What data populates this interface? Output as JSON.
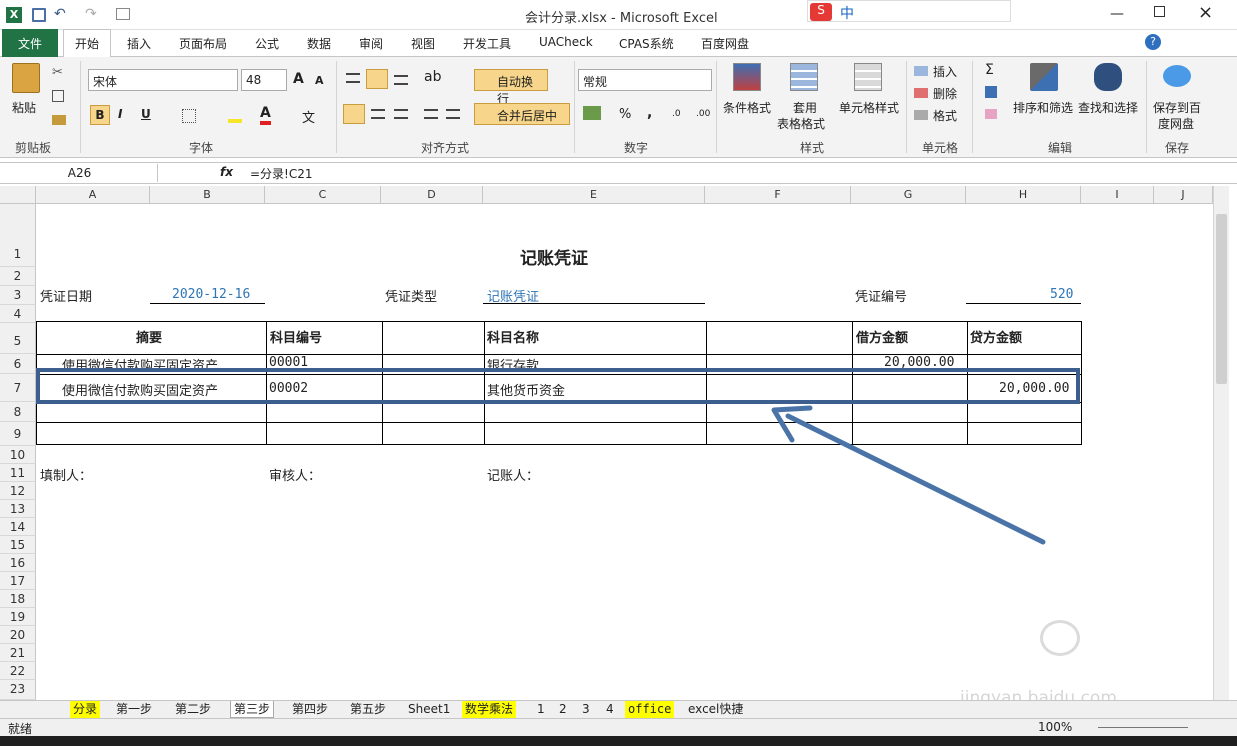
{
  "window": {
    "title": "会计分录.xlsx - Microsoft Excel"
  },
  "ime": {
    "label": "中"
  },
  "tabs": [
    "文件",
    "开始",
    "插入",
    "页面布局",
    "公式",
    "数据",
    "审阅",
    "视图",
    "开发工具",
    "UACheck",
    "CPAS系统",
    "百度网盘"
  ],
  "ribbon": {
    "paste": "粘贴",
    "clipboard": "剪贴板",
    "font_name": "宋体",
    "font_size": "48",
    "font_group": "字体",
    "wrap": "自动换行",
    "merge": "合并后居中",
    "align_group": "对齐方式",
    "number_format": "常规",
    "number_group": "数字",
    "cond_format": "条件格式",
    "table_format_1": "套用",
    "table_format_2": "表格格式",
    "cell_style": "单元格样式",
    "style_group": "样式",
    "insert": "插入",
    "delete": "删除",
    "format": "格式",
    "cells_group": "单元格",
    "sort_filter": "排序和筛选",
    "find_select": "查找和选择",
    "edit_group": "编辑",
    "save_baidu_1": "保存到百",
    "save_baidu_2": "度网盘",
    "save_group": "保存",
    "bold": "B",
    "italic": "I",
    "underline": "U",
    "percent": "%",
    "comma": ","
  },
  "formula": {
    "name_box": "A26",
    "fx": "fx",
    "content": "=分录!C21"
  },
  "columns": [
    "A",
    "B",
    "C",
    "D",
    "E",
    "F",
    "G",
    "H",
    "I",
    "J"
  ],
  "rows": [
    "1",
    "2",
    "3",
    "4",
    "5",
    "6",
    "7",
    "8",
    "9",
    "10",
    "11",
    "12",
    "13",
    "14",
    "15",
    "16",
    "17",
    "18",
    "19",
    "20",
    "21",
    "22",
    "23"
  ],
  "sheet": {
    "title": "记账凭证",
    "date_label": "凭证日期",
    "date_value": "2020-12-16",
    "type_label": "凭证类型",
    "type_value": "记账凭证",
    "no_label": "凭证编号",
    "no_value": "520",
    "headers": {
      "summary": "摘要",
      "code": "科目编号",
      "name": "科目名称",
      "debit": "借方金额",
      "credit": "贷方金额"
    },
    "row6": {
      "summary": "使用微信付款购买固定资产",
      "code": "00001",
      "name": "银行存款",
      "debit": "20,000.00",
      "credit": ""
    },
    "row7": {
      "summary": "使用微信付款购买固定资产",
      "code": "00002",
      "name": "其他货币资金",
      "debit": "",
      "credit": "20,000.00"
    },
    "maker": "填制人：",
    "reviewer": "审核人：",
    "bookkeeper": "记账人："
  },
  "sheet_tabs": [
    "分录",
    "第一步",
    "第二步",
    "第三步",
    "第四步",
    "第五步",
    "Sheet1",
    "数学乘法",
    "1",
    "2",
    "3",
    "4",
    "office",
    "excel快捷"
  ],
  "status": {
    "ready": "就绪",
    "zoom": "100%"
  },
  "watermark": {
    "text": "jingyan.baidu.com"
  },
  "colors": {
    "excel_green": "#217346",
    "highlight_box": "#3d5f8f",
    "arrow": "#4a74a8",
    "blue_text": "#2e75b6"
  }
}
